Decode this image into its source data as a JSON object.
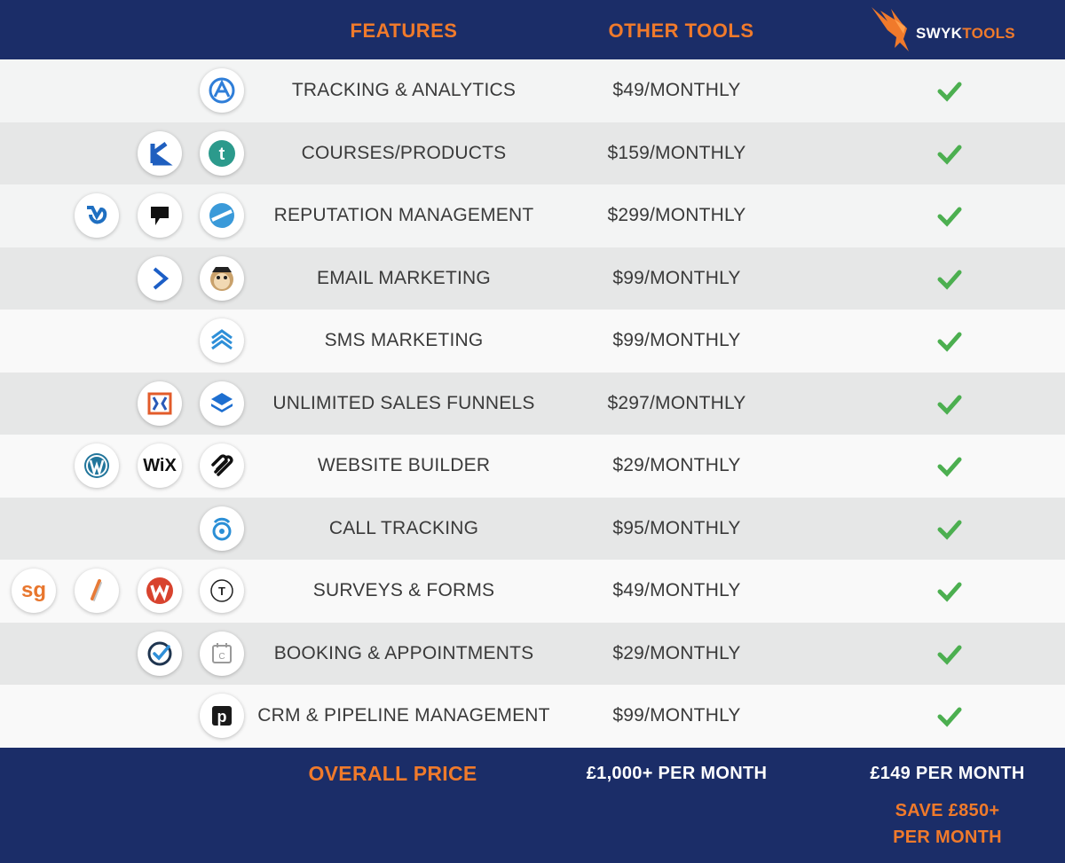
{
  "header": {
    "features_label": "FEATURES",
    "other_tools_label": "OTHER TOOLS",
    "brand_part1": "SWYK",
    "brand_part2": "TOOLS"
  },
  "rows": [
    {
      "feature": "TRACKING & ANALYTICS",
      "price": "$49/MONTHLY",
      "logos": [
        "analytics-logo"
      ]
    },
    {
      "feature": "COURSES/PRODUCTS",
      "price": "$159/MONTHLY",
      "logos": [
        "kajabi-logo",
        "teachable-logo"
      ]
    },
    {
      "feature": "REPUTATION MANAGEMENT",
      "price": "$299/MONTHLY",
      "logos": [
        "birdeye-logo",
        "podium-logo",
        "reputation-logo"
      ]
    },
    {
      "feature": "EMAIL MARKETING",
      "price": "$99/MONTHLY",
      "logos": [
        "activecampaign-logo",
        "mailchimp-logo"
      ]
    },
    {
      "feature": "SMS MARKETING",
      "price": "$99/MONTHLY",
      "logos": [
        "sms-logo"
      ]
    },
    {
      "feature": "UNLIMITED SALES FUNNELS",
      "price": "$297/MONTHLY",
      "logos": [
        "clickfunnels-logo",
        "funnel-layers-logo"
      ]
    },
    {
      "feature": "WEBSITE BUILDER",
      "price": "$29/MONTHLY",
      "logos": [
        "wordpress-logo",
        "wix-logo",
        "squarespace-logo"
      ]
    },
    {
      "feature": "CALL TRACKING",
      "price": "$95/MONTHLY",
      "logos": [
        "calltracking-logo"
      ]
    },
    {
      "feature": "SURVEYS & FORMS",
      "price": "$49/MONTHLY",
      "logos": [
        "surveygizmo-logo",
        "jotform-logo",
        "wufoo-logo",
        "typeform-logo"
      ]
    },
    {
      "feature": "BOOKING & APPOINTMENTS",
      "price": "$29/MONTHLY",
      "logos": [
        "acuity-logo",
        "calendly-logo"
      ]
    },
    {
      "feature": "CRM & PIPELINE MANAGEMENT",
      "price": "$99/MONTHLY",
      "logos": [
        "pipedrive-logo"
      ]
    }
  ],
  "logo_text": {
    "wix": "WiX",
    "surveygizmo": "sg",
    "typeform": "T",
    "pipedrive": "p",
    "teachable": "t",
    "calendly": "C"
  },
  "footer": {
    "overall_label": "OVERALL PRICE",
    "other_total": "£1,000+ PER MONTH",
    "swyk_total": "£149 PER MONTH",
    "save_line1": "SAVE £850+",
    "save_line2": "PER MONTH"
  },
  "colors": {
    "navy": "#1b2d68",
    "orange": "#f07a2b",
    "check_green": "#4caf50"
  }
}
